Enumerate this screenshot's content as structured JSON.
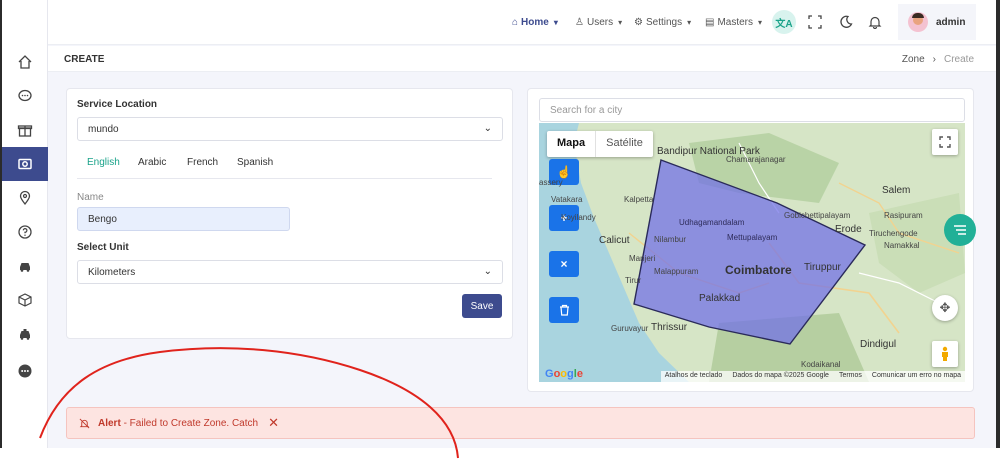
{
  "header": {
    "nav": [
      {
        "label": "Home",
        "icon": "home-icon"
      },
      {
        "label": "Users",
        "icon": "user-icon"
      },
      {
        "label": "Settings",
        "icon": "gear-icon"
      },
      {
        "label": "Masters",
        "icon": "file-icon"
      }
    ],
    "user_name": "admin"
  },
  "page": {
    "title": "CREATE",
    "breadcrumb": [
      "Zone",
      "Create"
    ]
  },
  "form": {
    "service_location_label": "Service Location",
    "service_location_value": "mundo",
    "tabs": [
      "English",
      "Arabic",
      "French",
      "Spanish"
    ],
    "active_tab": "English",
    "name_label": "Name",
    "name_value": "Bengo",
    "unit_label": "Select Unit",
    "unit_value": "Kilometers",
    "save_label": "Save"
  },
  "map": {
    "search_placeholder": "Search for a city",
    "type_map": "Mapa",
    "type_satellite": "Satélite",
    "tools": [
      "pointer",
      "+",
      "×",
      "delete"
    ],
    "labels": {
      "bandipur": "Bandipur National Park",
      "chamarajanagar": "Chamarajanagar",
      "kalpetta": "Kalpetta",
      "vatakara": "Vatakara",
      "koyilandy": "Koyilandy",
      "calicut": "Calicut",
      "nilambur": "Nilambur",
      "manjeri": "Manjeri",
      "malappuram": "Malappuram",
      "tirur": "Tirur",
      "udhagamandalam": "Udhagamandalam",
      "mettupalayam": "Mettupalayam",
      "gobichettipalayam": "Gobichettipalayam",
      "coimbatore": "Coimbatore",
      "tiruppur": "Tiruppur",
      "palakkad": "Palakkad",
      "guruvayur": "Guruvayur",
      "thrissur": "Thrissur",
      "salem": "Salem",
      "rasipuram": "Rasipuram",
      "erode": "Erode",
      "tiruchengode": "Tiruchengode",
      "namakkal": "Namakkal",
      "dindigul": "Dindigul",
      "kodaikanal": "Kodaikanal",
      "hassery": "assery"
    },
    "attribution": [
      "Atalhos de teclado",
      "Dados do mapa ©2025 Google",
      "Termos",
      "Comunicar um erro no mapa"
    ],
    "logo": "Google",
    "zone_fill": "#6f6ee8"
  },
  "alert": {
    "title": "Alert",
    "message": " - Failed to Create Zone. Catch",
    "color": "#c0392b"
  },
  "colors": {
    "brand": "#3d4b8e",
    "accent": "#1aa38a"
  }
}
